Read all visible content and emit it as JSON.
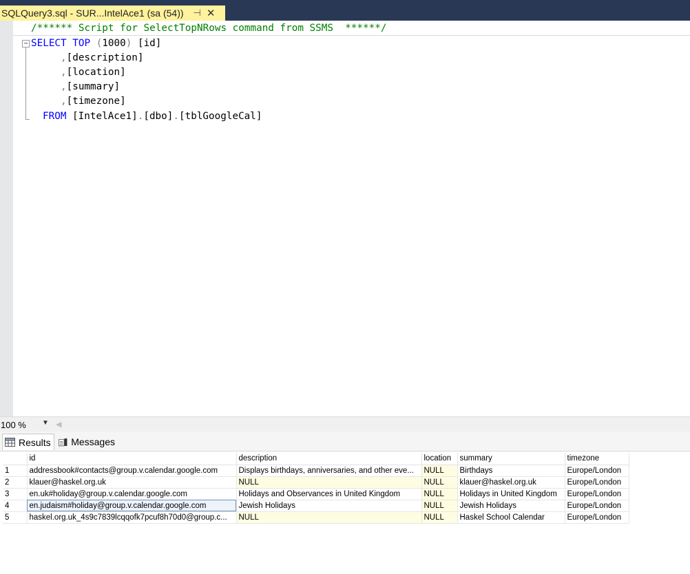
{
  "tab": {
    "title": "SQLQuery3.sql - SUR...IntelAce1 (sa (54))",
    "pin_glyph": "⊣",
    "close_glyph": "✕"
  },
  "editor": {
    "comment": "/****** Script for SelectTopNRows command from SSMS  ******/",
    "select_kw": "SELECT",
    "top_kw": "TOP",
    "top_open": "(",
    "top_value": "1000",
    "top_close": ")",
    "col_id": " [id]",
    "comma": ",",
    "columns": [
      "[description]",
      "[location]",
      "[summary]",
      "[timezone]"
    ],
    "from_kw": "FROM",
    "from_table_parts": [
      "[IntelAce1]",
      ".",
      "[dbo]",
      ".",
      "[tblGoogleCal]"
    ],
    "fold_glyph": "−"
  },
  "zoom": {
    "value": "100 %",
    "dropdown_glyph": "▼",
    "scroll_left_glyph": "◀"
  },
  "results_tabs": {
    "results_label": "Results",
    "messages_label": "Messages"
  },
  "grid": {
    "headers": [
      "id",
      "description",
      "location",
      "summary",
      "timezone"
    ],
    "rows": [
      {
        "n": "1",
        "id": "addressbook#contacts@group.v.calendar.google.com",
        "description": "Displays birthdays, anniversaries, and other eve...",
        "location": "NULL",
        "summary": "Birthdays",
        "timezone": "Europe/London"
      },
      {
        "n": "2",
        "id": "klauer@haskel.org.uk",
        "description": "NULL",
        "location": "NULL",
        "summary": "klauer@haskel.org.uk",
        "timezone": "Europe/London"
      },
      {
        "n": "3",
        "id": "en.uk#holiday@group.v.calendar.google.com",
        "description": "Holidays and Observances in United Kingdom",
        "location": "NULL",
        "summary": "Holidays in United Kingdom",
        "timezone": "Europe/London"
      },
      {
        "n": "4",
        "id": "en.judaism#holiday@group.v.calendar.google.com",
        "description": "Jewish Holidays",
        "location": "NULL",
        "summary": "Jewish Holidays",
        "timezone": "Europe/London"
      },
      {
        "n": "5",
        "id": "haskel.org.uk_4s9c7839lcqqofk7pcuf8h70d0@group.c...",
        "description": "NULL",
        "location": "NULL",
        "summary": "Haskel School Calendar",
        "timezone": "Europe/London"
      }
    ]
  },
  "colors": {
    "title_strip": "#293955",
    "active_tab": "#fff29d",
    "keyword": "#0000ff",
    "comment": "#008000",
    "null_cell": "#fffde1"
  }
}
